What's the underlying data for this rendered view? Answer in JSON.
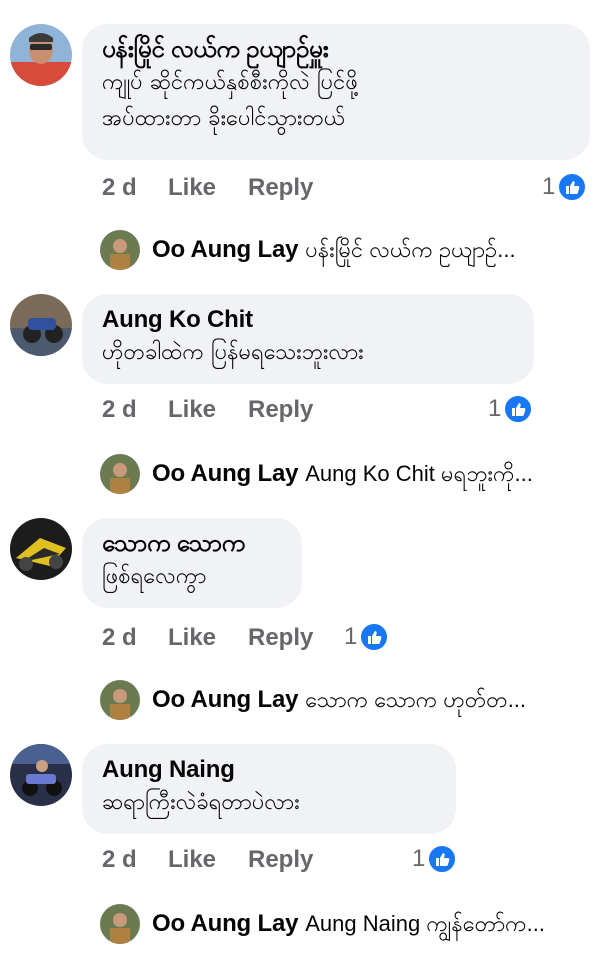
{
  "like_icon": "thumbs-up-icon",
  "colors": {
    "bubble": "#f0f2f5",
    "meta": "#65676b",
    "like_blue": "#1877f2"
  },
  "comments": [
    {
      "author": "ပန်းမြိုင် လယ်က ဥယျာဉ်မှူး",
      "text_lines": [
        "ကျုပ် ဆိုင်ကယ်နှစ်စီးကိုလဲ ပြင်ဖို့",
        "အပ်ထားတာ ခိုးပေါင်သွားတယ်"
      ],
      "time": "2 d",
      "like_label": "Like",
      "reply_label": "Reply",
      "reactions": "1",
      "reply": {
        "author": "Oo Aung Lay",
        "text": "ပန်းမြိုင် လယ်က ဥယျာဉ်..."
      }
    },
    {
      "author": "Aung Ko Chit",
      "text_lines": [
        "ဟိုတခါထဲက ပြန်မရသေးဘူးလား"
      ],
      "time": "2 d",
      "like_label": "Like",
      "reply_label": "Reply",
      "reactions": "1",
      "reply": {
        "author": "Oo Aung Lay",
        "text": "Aung Ko Chit မရဘူးကို..."
      }
    },
    {
      "author": "သောက သောက",
      "text_lines": [
        "ဖြစ်ရလေကွာ"
      ],
      "time": "2 d",
      "like_label": "Like",
      "reply_label": "Reply",
      "reactions": "1",
      "reply": {
        "author": "Oo Aung Lay",
        "text": "သောက သောက ဟုတ်တ..."
      }
    },
    {
      "author": "Aung Naing",
      "text_lines": [
        "ဆရာကြီးလဲခံရတာပဲလား"
      ],
      "time": "2 d",
      "like_label": "Like",
      "reply_label": "Reply",
      "reactions": "1",
      "reply": {
        "author": "Oo Aung Lay",
        "text": "Aung Naing ကျွန်တော်က..."
      }
    }
  ]
}
